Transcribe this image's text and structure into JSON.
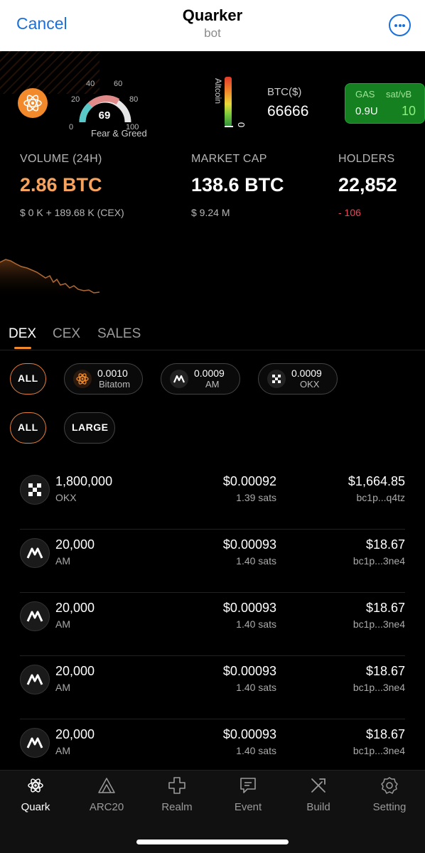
{
  "header": {
    "cancel_label": "Cancel",
    "title": "Quarker",
    "subtitle": "bot",
    "more_icon": "more-icon"
  },
  "gauge": {
    "ticks": [
      "0",
      "20",
      "40",
      "60",
      "80",
      "100"
    ],
    "value": "69",
    "label": "Fear & Greed"
  },
  "altcoin": {
    "label": "Altcoin",
    "value": "0"
  },
  "btc": {
    "label": "BTC($)",
    "value": "66666"
  },
  "gas": {
    "label": "GAS",
    "unit_label": "sat/vB",
    "usd": "0.9U",
    "satvb": "10"
  },
  "stats": {
    "volume": {
      "label": "VOLUME (24H)",
      "value": "2.86 BTC",
      "sub": "$ 0 K + 189.68 K (CEX)",
      "color": "#f6a35f"
    },
    "market_cap": {
      "label": "MARKET CAP",
      "value": "138.6 BTC",
      "sub": "$ 9.24 M"
    },
    "holders": {
      "label": "HOLDERS",
      "value": "22,852",
      "sub": "- 106",
      "sub_color": "#e8475a"
    }
  },
  "tabs": [
    {
      "label": "DEX"
    },
    {
      "label": "CEX"
    },
    {
      "label": "SALES"
    }
  ],
  "market_chips": [
    {
      "label": "ALL"
    },
    {
      "price": "0.0010",
      "name": "Bitatom",
      "icon": "atom-icon"
    },
    {
      "price": "0.0009",
      "name": "AM",
      "icon": "am-icon"
    },
    {
      "price": "0.0009",
      "name": "OKX",
      "icon": "okx-icon"
    }
  ],
  "size_chips": [
    {
      "label": "ALL"
    },
    {
      "label": "LARGE"
    }
  ],
  "orders": [
    {
      "qty": "1,800,000",
      "market": "OKX",
      "price": "$0.00092",
      "sats": "1.39 sats",
      "total": "$1,664.85",
      "addr": "bc1p...q4tz",
      "icon": "okx-icon"
    },
    {
      "qty": "20,000",
      "market": "AM",
      "price": "$0.00093",
      "sats": "1.40 sats",
      "total": "$18.67",
      "addr": "bc1p...3ne4",
      "icon": "am-icon"
    },
    {
      "qty": "20,000",
      "market": "AM",
      "price": "$0.00093",
      "sats": "1.40 sats",
      "total": "$18.67",
      "addr": "bc1p...3ne4",
      "icon": "am-icon"
    },
    {
      "qty": "20,000",
      "market": "AM",
      "price": "$0.00093",
      "sats": "1.40 sats",
      "total": "$18.67",
      "addr": "bc1p...3ne4",
      "icon": "am-icon"
    },
    {
      "qty": "20,000",
      "market": "AM",
      "price": "$0.00093",
      "sats": "1.40 sats",
      "total": "$18.67",
      "addr": "bc1p...3ne4",
      "icon": "am-icon"
    }
  ],
  "nav": [
    {
      "label": "Quark",
      "icon": "atom-icon"
    },
    {
      "label": "ARC20",
      "icon": "arc20-icon"
    },
    {
      "label": "Realm",
      "icon": "realm-icon"
    },
    {
      "label": "Event",
      "icon": "event-icon"
    },
    {
      "label": "Build",
      "icon": "build-icon"
    },
    {
      "label": "Setting",
      "icon": "gear-icon"
    }
  ],
  "colors": {
    "accent": "#f28a2c",
    "link": "#1a6fd8",
    "gas_bg": "#14801f"
  }
}
